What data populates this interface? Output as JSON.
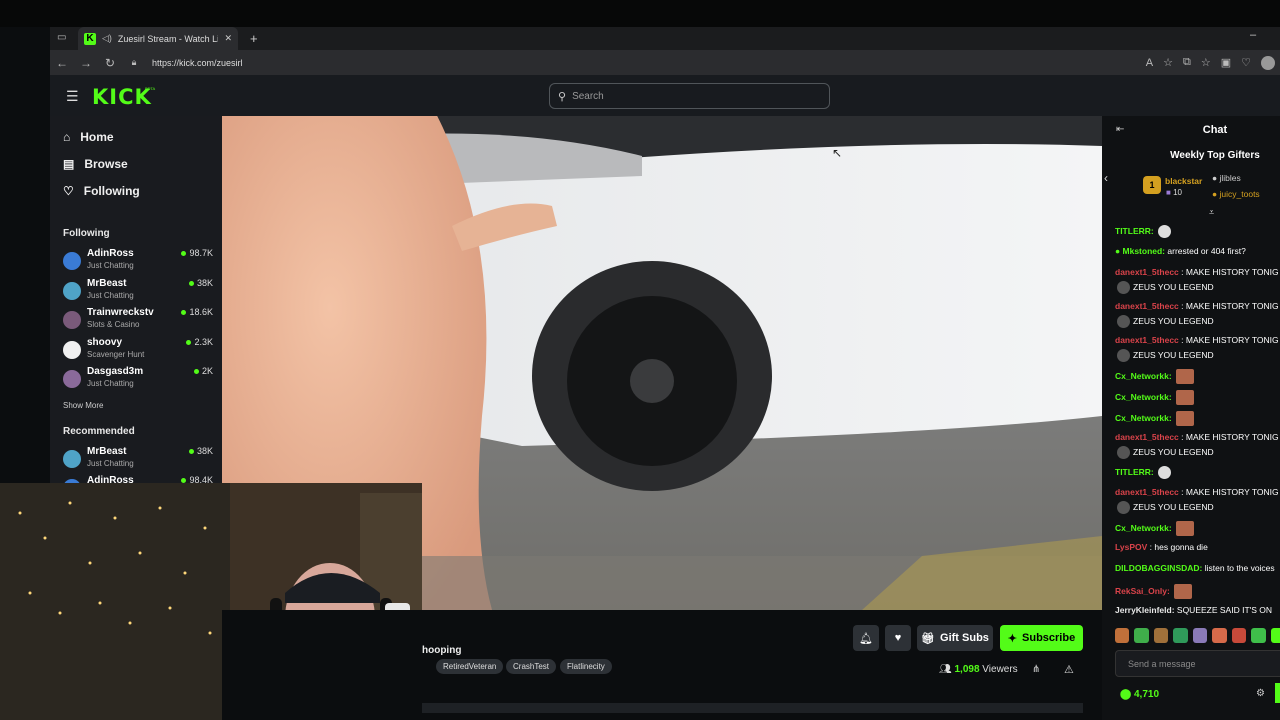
{
  "browser": {
    "tab_title": "Zuesirl Stream - Watch Live o",
    "url": "https://kick.com/zuesirl",
    "new_tab_label": "+"
  },
  "header": {
    "logo": "KICK",
    "badge": "BETA",
    "search_placeholder": "Search"
  },
  "sidebar": {
    "nav": [
      {
        "label": "Home",
        "icon": "home-icon"
      },
      {
        "label": "Browse",
        "icon": "browse-icon"
      },
      {
        "label": "Following",
        "icon": "heart-icon"
      }
    ],
    "following_title": "Following",
    "following": [
      {
        "name": "AdinRoss",
        "category": "Just Chatting",
        "viewers": "98.7K",
        "color": "#3a7bd5"
      },
      {
        "name": "MrBeast",
        "category": "Just Chatting",
        "viewers": "38K",
        "color": "#4fa3c7"
      },
      {
        "name": "Trainwreckstv",
        "category": "Slots & Casino",
        "viewers": "18.6K",
        "color": "#7a5a7a"
      },
      {
        "name": "shoovy",
        "category": "Scavenger Hunt",
        "viewers": "2.3K",
        "color": "#f0f0f0"
      },
      {
        "name": "Dasgasd3m",
        "category": "Just Chatting",
        "viewers": "2K",
        "color": "#8a6a9a"
      }
    ],
    "show_more": "Show More",
    "recommended_title": "Recommended",
    "recommended": [
      {
        "name": "MrBeast",
        "category": "Just Chatting",
        "viewers": "38K",
        "color": "#4fa3c7"
      },
      {
        "name": "AdinRoss",
        "category": "",
        "viewers": "98.4K",
        "color": "#3a7bd5"
      }
    ]
  },
  "stream": {
    "title_fragment": "hooping",
    "tags": [
      "RetiredVeteran",
      "CrashTest",
      "Flatlinecity"
    ],
    "gift_subs": "Gift Subs",
    "subscribe": "Subscribe",
    "viewers_count": "1,098",
    "viewers_label": "Viewers"
  },
  "chat": {
    "title": "Chat",
    "weekly_title": "Weekly Top Gifters",
    "gifters": [
      {
        "rank": "1",
        "name": "blackstar",
        "count": "10"
      },
      {
        "name": "jlibles"
      },
      {
        "name": "juicy_toots"
      }
    ],
    "messages": [
      {
        "user": "TITLERR:",
        "text": "",
        "ucolor": "#53fc18",
        "emote": "skull"
      },
      {
        "user": "Mkstoned:",
        "text": "arrested or 404 first?",
        "ucolor": "#53fc18",
        "badge": true
      },
      {
        "user": "danext1_5thecc",
        "text": ": MAKE HISTORY TONIG",
        "ucolor": "#d9434a",
        "cont": "ZEUS YOU LEGEND"
      },
      {
        "user": "danext1_5thecc",
        "text": ": MAKE HISTORY TONIG",
        "ucolor": "#d9434a",
        "cont": "ZEUS YOU LEGEND"
      },
      {
        "user": "danext1_5thecc",
        "text": ": MAKE HISTORY TONIG",
        "ucolor": "#d9434a",
        "cont": "ZEUS YOU LEGEND"
      },
      {
        "user": "Cx_Networkk:",
        "text": "",
        "ucolor": "#53fc18",
        "emote": "face"
      },
      {
        "user": "Cx_Networkk:",
        "text": "",
        "ucolor": "#53fc18",
        "emote": "face"
      },
      {
        "user": "Cx_Networkk:",
        "text": "",
        "ucolor": "#53fc18",
        "emote": "face"
      },
      {
        "user": "danext1_5thecc",
        "text": ": MAKE HISTORY TONIG",
        "ucolor": "#d9434a",
        "cont": "ZEUS YOU LEGEND"
      },
      {
        "user": "TITLERR:",
        "text": "",
        "ucolor": "#53fc18",
        "emote": "skull"
      },
      {
        "user": "danext1_5thecc",
        "text": ": MAKE HISTORY TONIG",
        "ucolor": "#d9434a",
        "cont": "ZEUS YOU LEGEND"
      },
      {
        "user": "Cx_Networkk:",
        "text": "",
        "ucolor": "#53fc18",
        "emote": "face"
      },
      {
        "user": "LysPOV",
        "text": ": hes gonna die",
        "ucolor": "#d9434a"
      },
      {
        "user": "DILDOBAGGINSDAD:",
        "text": "listen to the voices",
        "ucolor": "#53fc18"
      },
      {
        "user": "RekSai_Only:",
        "text": "",
        "ucolor": "#d9434a",
        "emote": "face"
      },
      {
        "user": "JerryKleinfeld:",
        "text": "SQUEEZE SAID IT'S ON",
        "ucolor": "#e8e8e8"
      }
    ],
    "send_placeholder": "Send a message",
    "points": "4,710"
  },
  "colors": {
    "accent": "#53fc18",
    "bg": "#0b0d0f",
    "panel": "#191b1f"
  }
}
